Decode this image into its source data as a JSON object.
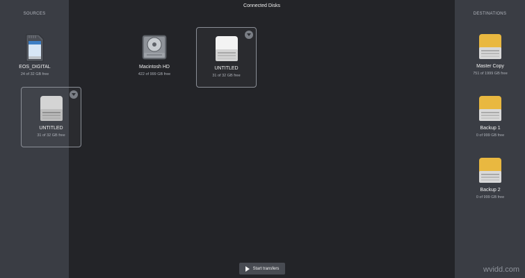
{
  "window": {
    "title": "Connected Disks"
  },
  "sources": {
    "title": "SOURCES",
    "items": [
      {
        "name": "EOS_DIGITAL",
        "free": "24 of 32 GB free",
        "icon": "sd-card-icon"
      },
      {
        "name": "UNTITLED",
        "free": "31 of 32 GB free",
        "icon": "white-drive-icon"
      }
    ]
  },
  "connected": {
    "items": [
      {
        "name": "Macintosh HD",
        "free": "422 of 999 GB free",
        "icon": "internal-hard-drive-icon"
      },
      {
        "name": "UNTITLED",
        "free": "31 of 32 GB free",
        "icon": "white-drive-icon"
      }
    ]
  },
  "destinations": {
    "title": "DESTINATIONS",
    "items": [
      {
        "name": "Master Copy",
        "free": "751 of 1999 GB free",
        "icon": "yellow-drive-icon"
      },
      {
        "name": "Backup 1",
        "free": "0 of 999 GB free",
        "icon": "yellow-drive-icon"
      },
      {
        "name": "Backup 2",
        "free": "0 of 999 GB free",
        "icon": "yellow-drive-icon"
      }
    ]
  },
  "actions": {
    "start_transfers": "Start transfers"
  },
  "watermark": "wvidd.com"
}
